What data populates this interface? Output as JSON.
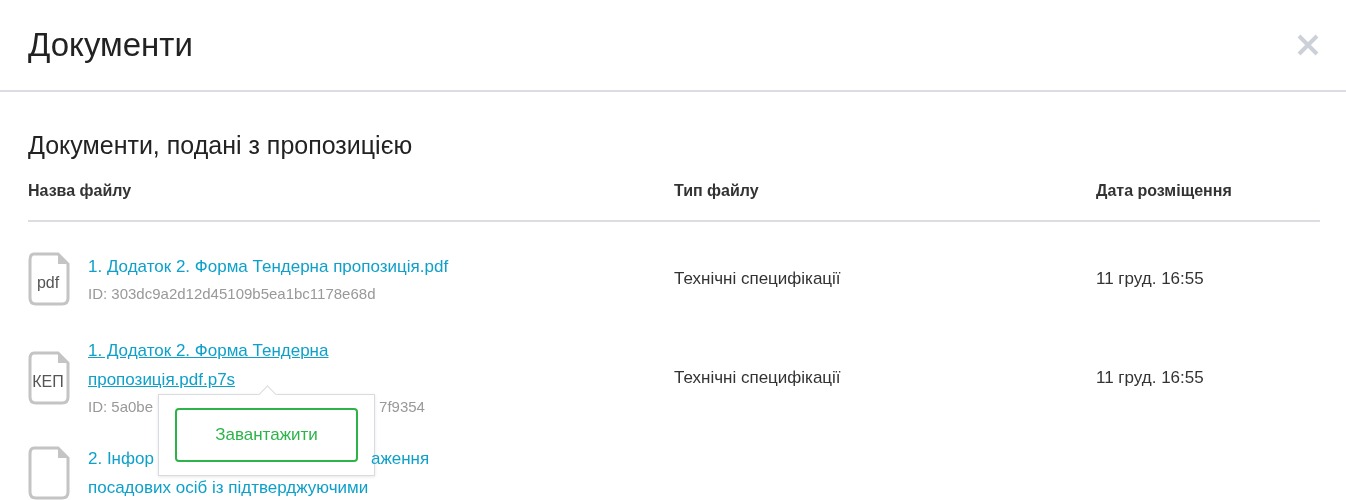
{
  "window": {
    "title": "Документи"
  },
  "section": {
    "title": "Документи, подані з пропозицією"
  },
  "table": {
    "columns": [
      "Назва файлу",
      "Тип файлу",
      "Дата розміщення"
    ],
    "rows": [
      {
        "icon_label": "pdf",
        "title_lines": [
          [
            "1. Додаток 2. Форма Тендерна пропозиція.pdf"
          ]
        ],
        "id_parts": [
          "ID: 303dc9a2d12d45109b5ea1bc1178e68d"
        ],
        "type": "Технічні специфікації",
        "date": "11 груд. 16:55",
        "hovered": false
      },
      {
        "icon_label": "КЕП",
        "title_lines": [
          [
            "1. Додаток 2. Форма Тендерна"
          ],
          [
            "пропозиція.pdf.p7s"
          ]
        ],
        "id_parts": [
          "ID: 5a0be",
          "7f9354"
        ],
        "type": "Технічні специфікації",
        "date": "11 груд. 16:55",
        "hovered": true
      },
      {
        "icon_label": "",
        "title_lines": [
          [
            "2. Інфор",
            "аження"
          ],
          [
            "посадових осіб із підтверджуючими"
          ]
        ],
        "id_parts": [],
        "hovered": false
      }
    ]
  },
  "popover": {
    "button": "Завантажити"
  }
}
